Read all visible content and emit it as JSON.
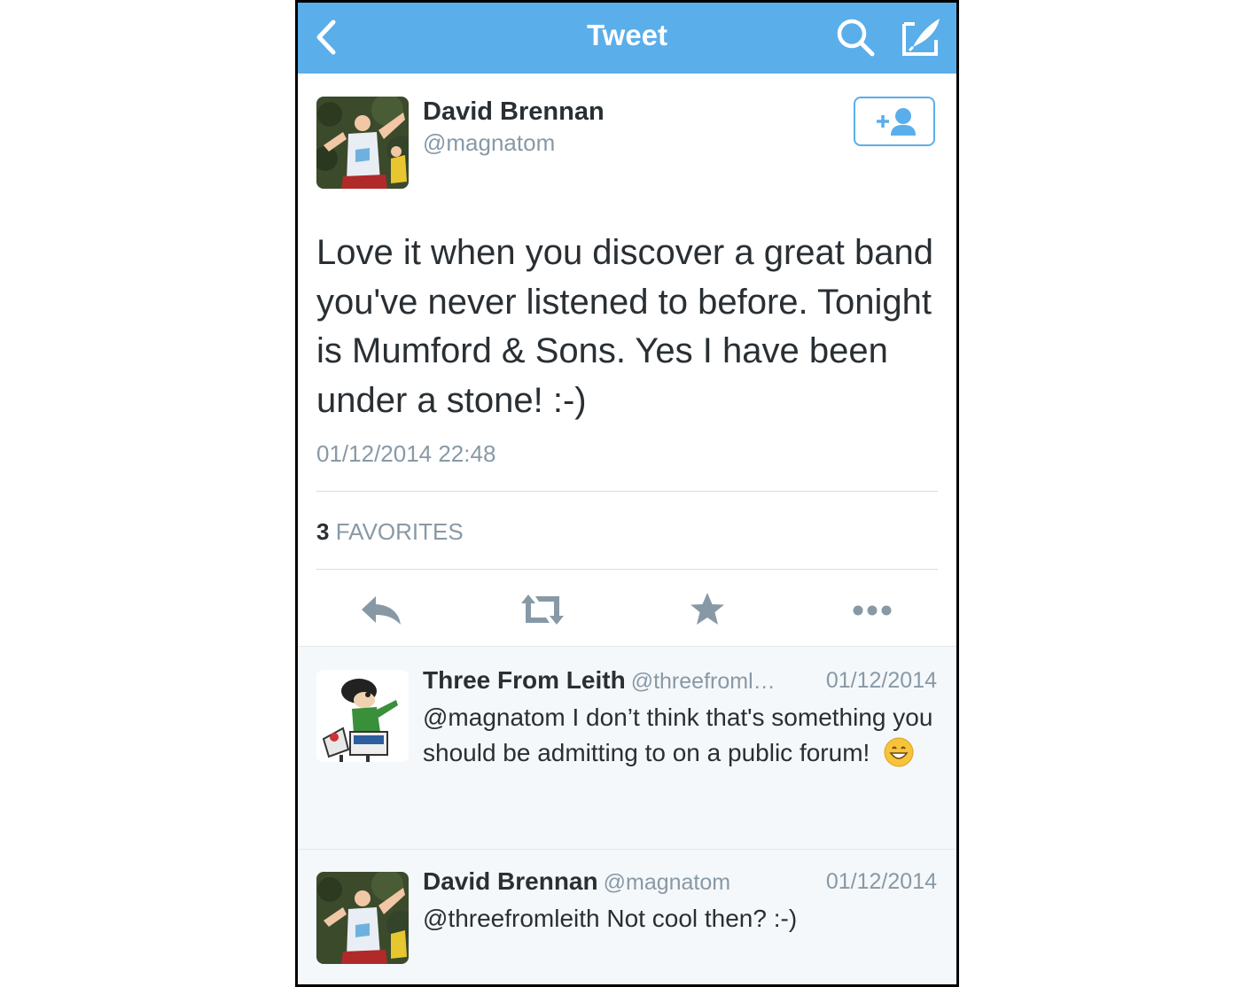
{
  "nav": {
    "title": "Tweet",
    "back_icon": "chevron-left-icon",
    "search_icon": "search-icon",
    "compose_icon": "compose-icon",
    "bar_color": "#5aaeea"
  },
  "tweet": {
    "author_name": "David Brennan",
    "author_handle": "@magnatom",
    "text": "Love it when you discover a great band you've never listened to before. Tonight is Mumford & Sons. Yes I have been under a stone! :-)",
    "timestamp": "01/12/2014 22:48",
    "favorites_count": "3",
    "favorites_label": "FAVORITES",
    "follow_icon": "add-user-icon"
  },
  "actions": [
    "reply-icon",
    "retweet-icon",
    "favorite-star-icon",
    "more-icon"
  ],
  "replies": [
    {
      "name": "Three From Leith",
      "handle": "@threefroml…",
      "date": "01/12/2014",
      "text": "@magnatom I don’t think that's something you should be admitting to on a public forum!",
      "emoji": "grinning-face-emoji"
    },
    {
      "name": "David Brennan",
      "handle": "@magnatom",
      "date": "01/12/2014",
      "text": "@threefromleith Not cool then? :-)"
    }
  ]
}
